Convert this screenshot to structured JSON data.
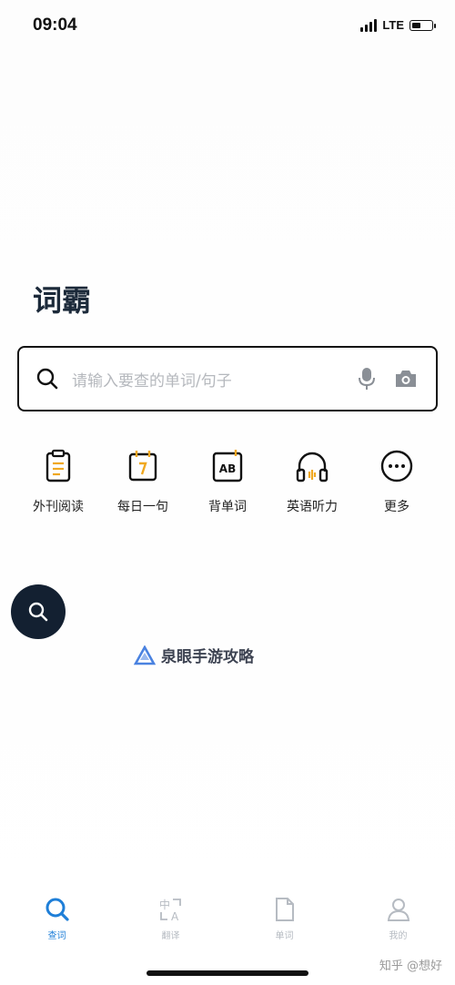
{
  "status_bar": {
    "time": "09:04",
    "network": "LTE"
  },
  "app": {
    "logo_text": "词霸"
  },
  "search": {
    "placeholder": "请输入要查的单词/句子"
  },
  "quick_actions": [
    {
      "label": "外刊阅读",
      "icon": "clipboard-icon"
    },
    {
      "label": "每日一句",
      "icon": "calendar-icon"
    },
    {
      "label": "背单词",
      "icon": "ab-card-icon"
    },
    {
      "label": "英语听力",
      "icon": "headphones-icon"
    },
    {
      "label": "更多",
      "icon": "more-icon"
    }
  ],
  "watermark": {
    "text": "泉眼手游攻略"
  },
  "tabbar": [
    {
      "label": "查词",
      "icon": "search-icon",
      "active": true
    },
    {
      "label": "翻译",
      "icon": "translate-icon",
      "active": false
    },
    {
      "label": "单词",
      "icon": "document-icon",
      "active": false
    },
    {
      "label": "我的",
      "icon": "person-icon",
      "active": false
    }
  ],
  "credit": "知乎 @想好",
  "colors": {
    "accent": "#1f7fd8",
    "dark": "#132031",
    "inactive": "#b6bbc2",
    "highlight": "#f0a820"
  }
}
